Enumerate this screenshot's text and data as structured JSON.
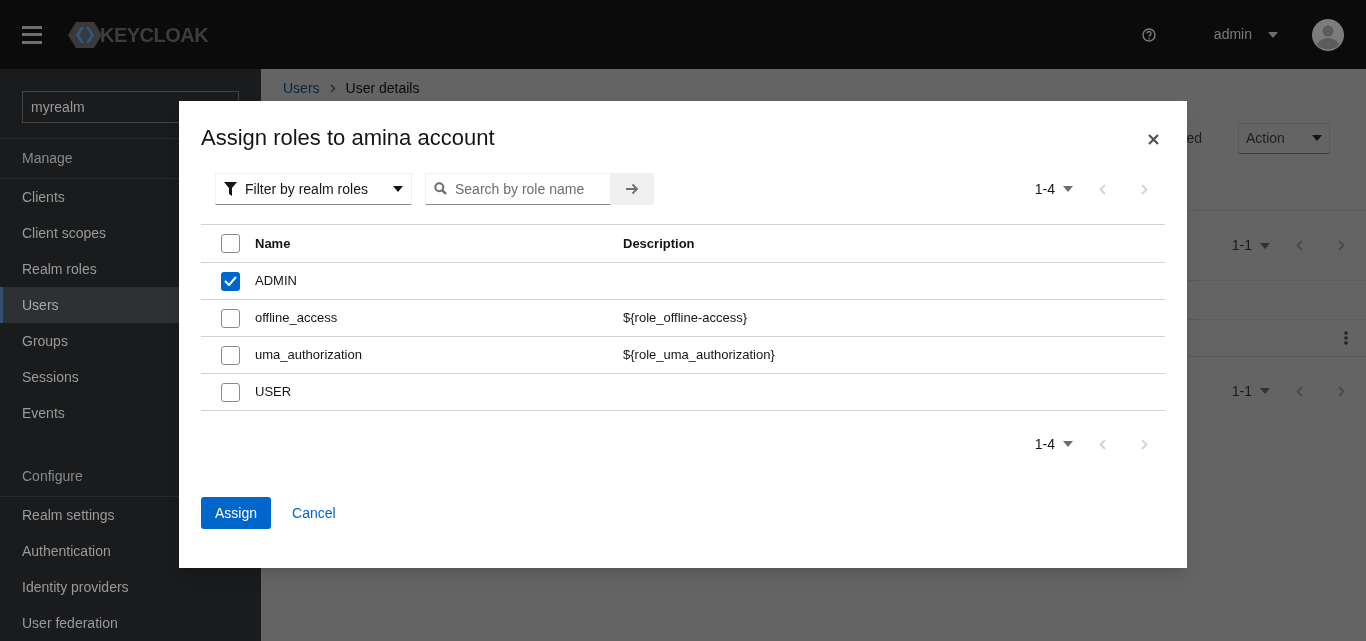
{
  "header": {
    "logo": "KEYCLOAK",
    "user": "admin"
  },
  "sidebar": {
    "realm": "myrealm",
    "sections": [
      {
        "title": "Manage",
        "items": [
          {
            "label": "Clients",
            "selected": false
          },
          {
            "label": "Client scopes",
            "selected": false
          },
          {
            "label": "Realm roles",
            "selected": false
          },
          {
            "label": "Users",
            "selected": true
          },
          {
            "label": "Groups",
            "selected": false
          },
          {
            "label": "Sessions",
            "selected": false
          },
          {
            "label": "Events",
            "selected": false
          }
        ]
      },
      {
        "title": "Configure",
        "items": [
          {
            "label": "Realm settings",
            "selected": false
          },
          {
            "label": "Authentication",
            "selected": false
          },
          {
            "label": "Identity providers",
            "selected": false
          },
          {
            "label": "User federation",
            "selected": false
          }
        ]
      }
    ]
  },
  "page": {
    "breadcrumb": [
      "Users",
      "User details"
    ],
    "status_text": "ed",
    "action": "Action",
    "paginations": [
      {
        "range": "1-1",
        "prev_disabled": true,
        "next_disabled": true
      },
      {
        "range": "1-1",
        "prev_disabled": true,
        "next_disabled": true
      }
    ]
  },
  "dialog": {
    "title": "Assign roles to amina account",
    "filter": "Filter by realm roles",
    "search_placeholder": "Search by role name",
    "pagination_top": {
      "range": "1-4",
      "prev_disabled": true,
      "next_disabled": true
    },
    "select_all_checked": false,
    "columns": [
      "Name",
      "Description"
    ],
    "rows": [
      {
        "name": "ADMIN",
        "description": "",
        "checked": true
      },
      {
        "name": "offline_access",
        "description": "${role_offline-access}",
        "checked": false
      },
      {
        "name": "uma_authorization",
        "description": "${role_uma_authorization}",
        "checked": false
      },
      {
        "name": "USER",
        "description": "",
        "checked": false
      }
    ],
    "pagination_bottom": {
      "range": "1-4",
      "prev_disabled": true,
      "next_disabled": true
    },
    "primary_button": "Assign",
    "cancel_link": "Cancel"
  }
}
